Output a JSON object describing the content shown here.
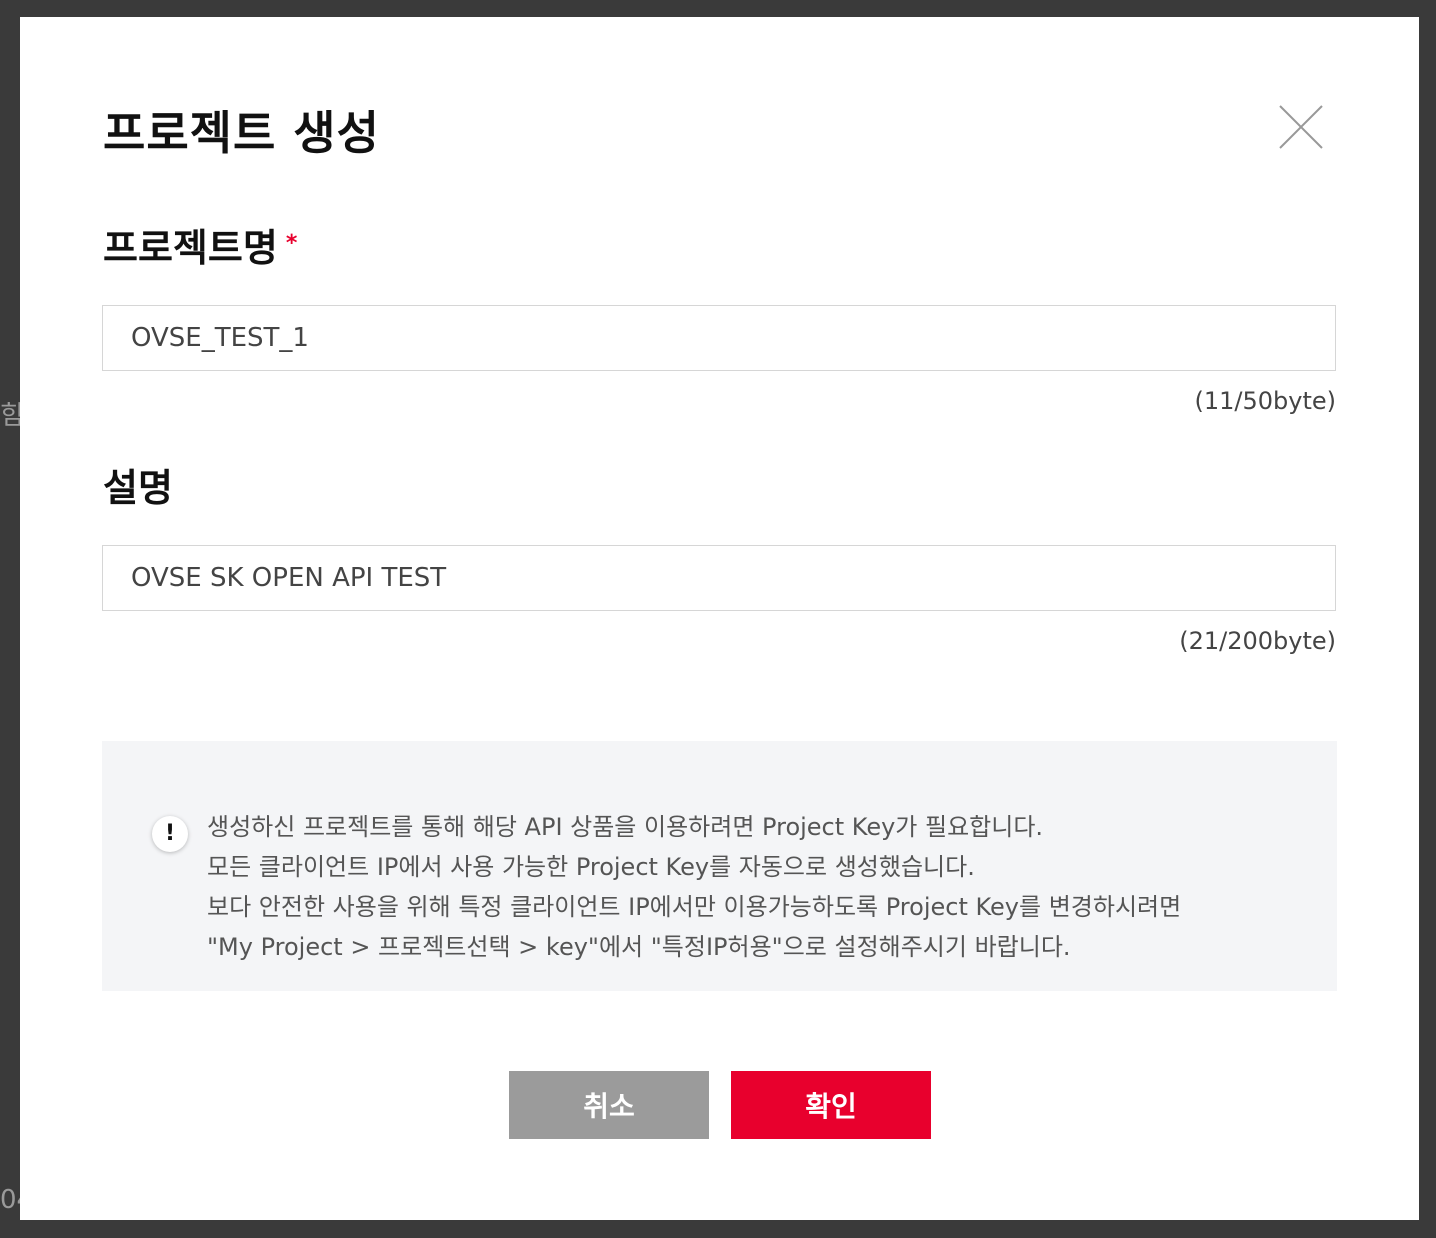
{
  "backdrop": {
    "edge_text_1": "힘",
    "edge_text_2": "04"
  },
  "modal": {
    "title": "프로젝트 생성",
    "close_icon": "close-icon",
    "project_name": {
      "label": "프로젝트명",
      "required_mark": "*",
      "value": "OVSE_TEST_1",
      "counter": "(11/50byte)"
    },
    "description": {
      "label": "설명",
      "value": "OVSE SK OPEN API TEST",
      "counter": "(21/200byte)"
    },
    "notice": {
      "icon": "!",
      "lines": [
        "생성하신 프로젝트를 통해 해당 API 상품을 이용하려면 Project Key가 필요합니다.",
        "모든 클라이언트 IP에서 사용 가능한 Project Key를 자동으로 생성했습니다.",
        "보다 안전한 사용을 위해 특정 클라이언트 IP에서만 이용가능하도록 Project Key를 변경하시려면",
        "\"My Project > 프로젝트선택 > key\"에서 \"특정IP허용\"으로 설정해주시기 바랍니다."
      ]
    },
    "buttons": {
      "cancel_label": "취소",
      "confirm_label": "확인"
    }
  },
  "colors": {
    "accent": "#e8002d",
    "cancel": "#9b9b9b",
    "notice_bg": "#f4f5f7",
    "backdrop": "#3a3a3a"
  }
}
